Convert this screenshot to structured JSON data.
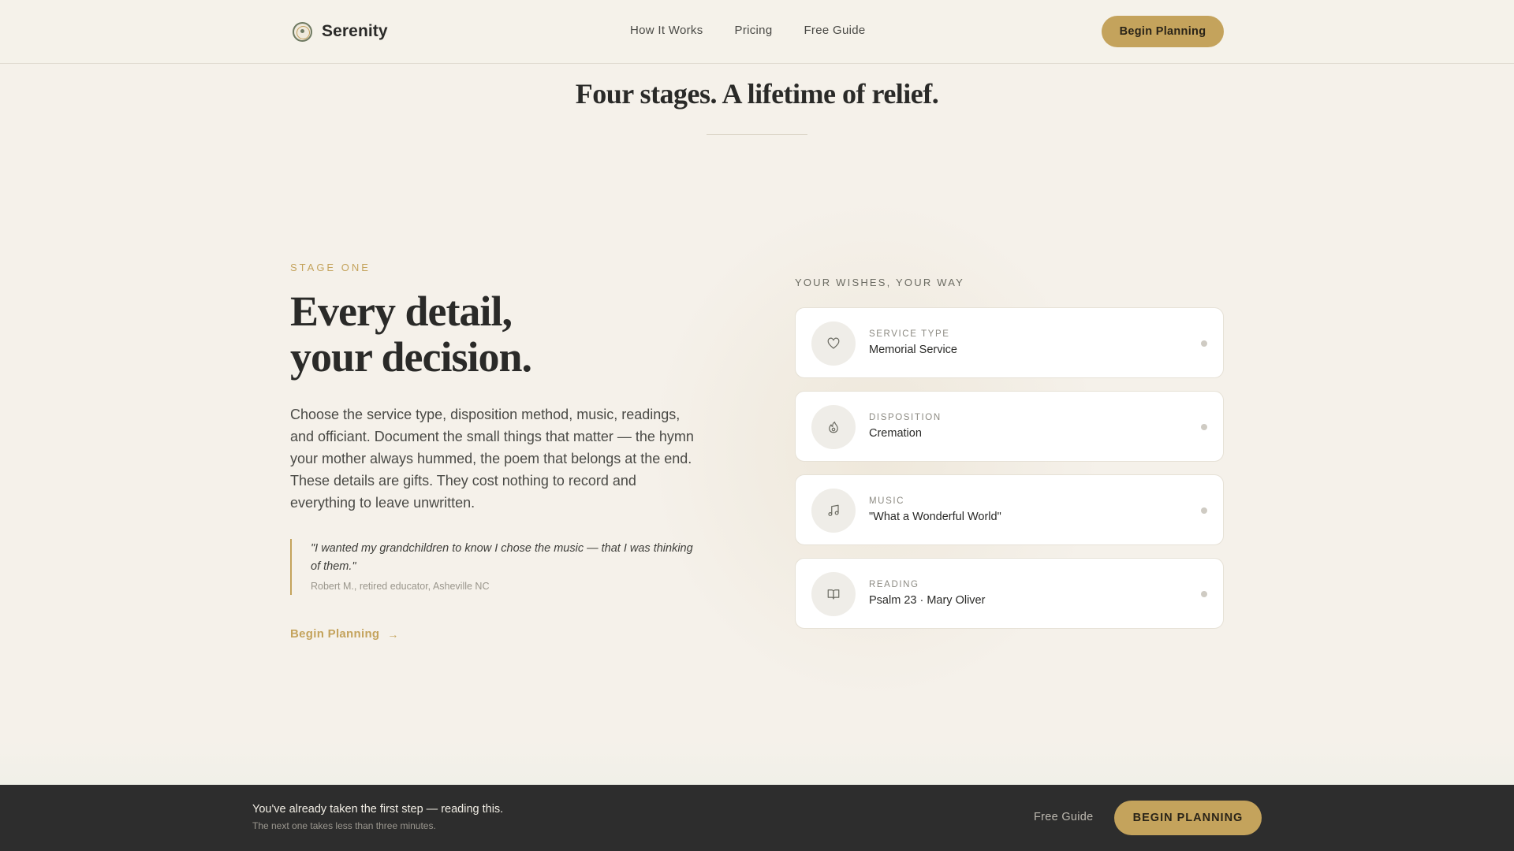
{
  "header": {
    "brand": "Serenity",
    "nav": [
      "How It Works",
      "Pricing",
      "Free Guide"
    ],
    "cta_label": "Begin Planning"
  },
  "section": {
    "title": "Four stages. A lifetime of relief."
  },
  "stage": {
    "eyebrow": "STAGE ONE",
    "headline_line1": "Every detail,",
    "headline_line2": "your decision.",
    "body": "Choose the service type, disposition method, music, readings, and officiant. Document the small things that matter — the hymn your mother always hummed, the poem that belongs at the end. These details are gifts. They cost nothing to record and everything to leave unwritten.",
    "quote": "\"I wanted my grandchildren to know I chose the music — that I was thinking of them.\"",
    "quote_attribution": "Robert M., retired educator, Asheville NC",
    "cta_label": "Begin Planning",
    "cta_arrow": "→"
  },
  "wishes": {
    "label": "YOUR WISHES, YOUR WAY",
    "items": [
      {
        "label": "SERVICE TYPE",
        "value": "Memorial Service",
        "icon": "heart-icon"
      },
      {
        "label": "DISPOSITION",
        "value": "Cremation",
        "icon": "flame-icon"
      },
      {
        "label": "MUSIC",
        "value": "\"What a Wonderful World\"",
        "icon": "music-note-icon"
      },
      {
        "label": "READING",
        "value": "Psalm 23 · Mary Oliver",
        "icon": "open-book-icon"
      }
    ]
  },
  "bottom_bar": {
    "primary": "You've already taken the first step — reading this.",
    "secondary": "The next one takes less than three minutes.",
    "link_label": "Free Guide",
    "cta_label": "BEGIN PLANNING"
  },
  "colors": {
    "accent": "#c4a35c",
    "background": "#f5f1ea",
    "dark_bar": "#2d2d2d",
    "text": "#2a2a28"
  }
}
